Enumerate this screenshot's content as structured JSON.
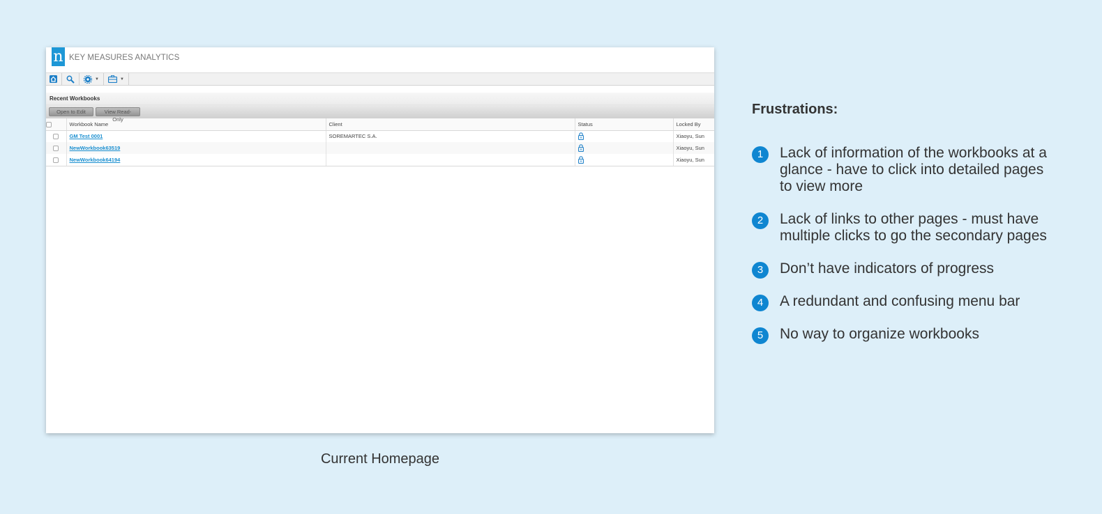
{
  "app": {
    "logo_letter": "n",
    "title": "KEY MEASURES ANALYTICS"
  },
  "toolbar": {
    "icons": [
      "home-icon",
      "search-icon",
      "gear-icon",
      "briefcase-icon"
    ],
    "caret": "▼"
  },
  "recent_workbooks": {
    "heading": "Recent Workbooks",
    "buttons": {
      "open_to_edit": "Open to Edit",
      "view_read_only": "View Read-Only"
    },
    "columns": {
      "name": "Workbook Name",
      "client": "Client",
      "status": "Status",
      "locked_by": "Locked By"
    },
    "rows": [
      {
        "name": "GM Test 0001",
        "client": "SOREMARTEC S.A.",
        "status_icon": "lock-icon",
        "locked_by": "Xiaoyu, Sun"
      },
      {
        "name": "NewWorkbook63519",
        "client": "",
        "status_icon": "lock-icon",
        "locked_by": "Xiaoyu, Sun"
      },
      {
        "name": "NewWorkbook64194",
        "client": "",
        "status_icon": "lock-icon",
        "locked_by": "Xiaoyu, Sun"
      }
    ]
  },
  "caption": "Current Homepage",
  "frustrations": {
    "title": "Frustrations:",
    "items": [
      {
        "number": "1",
        "text": "Lack of information of the workbooks at a glance - have to click into detailed pages to view more"
      },
      {
        "number": "2",
        "text": "Lack of links to other pages - must have multiple clicks to go the secondary pages"
      },
      {
        "number": "3",
        "text": "Don’t have indicators of progress"
      },
      {
        "number": "4",
        "text": "A redundant and confusing menu bar"
      },
      {
        "number": "5",
        "text": "No way to organize workbooks"
      }
    ]
  },
  "colors": {
    "background": "#ddeff9",
    "accent": "#0f86d1",
    "link": "#1a8fd0"
  }
}
